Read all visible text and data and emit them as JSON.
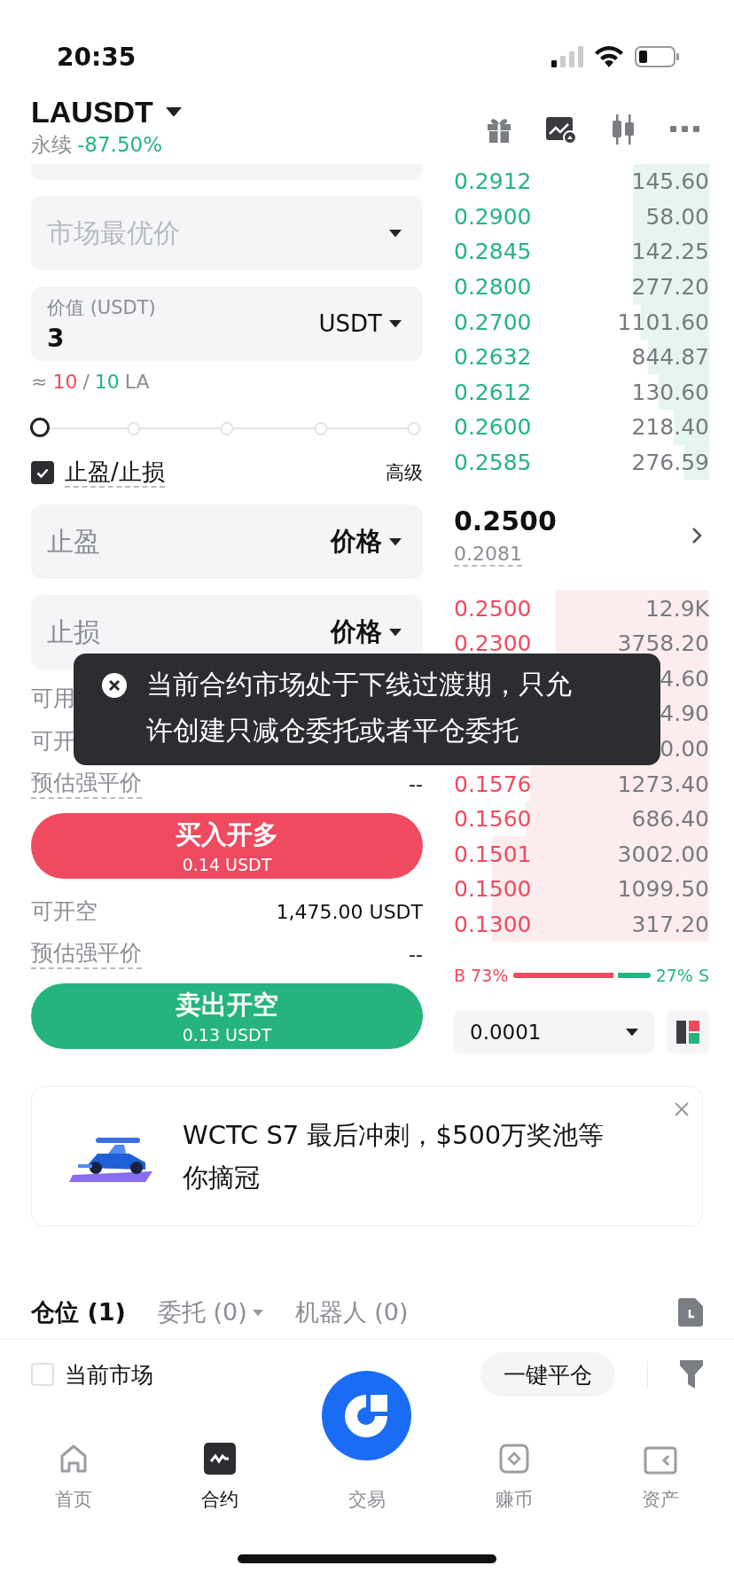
{
  "status_bar": {
    "time": "20:35"
  },
  "header": {
    "symbol": "LAUSDT",
    "type": "永续",
    "change": "-87.50%"
  },
  "order_form": {
    "order_type": {
      "placeholder": "市场最优价"
    },
    "value_field": {
      "label": "价值 (USDT)",
      "value": "3",
      "unit": "USDT"
    },
    "estimate": {
      "prefix": "≈",
      "long": "10",
      "separator": "/",
      "short": "10",
      "unit": "LA"
    },
    "slider": {
      "level": 0
    },
    "tp_sl": {
      "label": "止盈/止损",
      "checked": true,
      "advanced": "高级"
    },
    "tp_field": {
      "placeholder": "止盈",
      "mode": "价格"
    },
    "sl_field": {
      "placeholder": "止损",
      "mode": "价格"
    },
    "long_info": [
      {
        "label": "可用",
        "underlined": false
      },
      {
        "label": "可开",
        "underlined": false
      },
      {
        "label": "预估强平价",
        "value": "--",
        "underlined": true
      }
    ],
    "buy_button": {
      "label": "买入开多",
      "amount": "0.14 USDT"
    },
    "short_info": [
      {
        "label": "可开空",
        "value": "1,475.00 USDT",
        "underlined": false
      },
      {
        "label": "预估强平价",
        "value": "--",
        "underlined": true
      }
    ],
    "sell_button": {
      "label": "卖出开空",
      "amount": "0.13 USDT"
    }
  },
  "order_book": {
    "asks": [
      {
        "price": "0.2912",
        "amount": "145.60"
      },
      {
        "price": "0.2900",
        "amount": "58.00"
      },
      {
        "price": "0.2845",
        "amount": "142.25"
      },
      {
        "price": "0.2800",
        "amount": "277.20"
      },
      {
        "price": "0.2700",
        "amount": "1101.60"
      },
      {
        "price": "0.2632",
        "amount": "844.87"
      },
      {
        "price": "0.2612",
        "amount": "130.60"
      },
      {
        "price": "0.2600",
        "amount": "218.40"
      },
      {
        "price": "0.2585",
        "amount": "276.59"
      }
    ],
    "last_price": "0.2500",
    "mark_price": "0.2081",
    "bids": [
      {
        "price": "0.2500",
        "amount": "12.9K"
      },
      {
        "price": "0.2300",
        "amount": "3758.20"
      },
      {
        "amount": "4.60"
      },
      {
        "amount": "4.90"
      },
      {
        "amount": "0.00"
      },
      {
        "price": "0.1576",
        "amount": "1273.40"
      },
      {
        "price": "0.1560",
        "amount": "686.40"
      },
      {
        "price": "0.1501",
        "amount": "3002.00"
      },
      {
        "price": "0.1500",
        "amount": "1099.50"
      },
      {
        "price": "0.1300",
        "amount": "317.20"
      }
    ],
    "ratio": {
      "buy": "B 73%",
      "sell": "27% S",
      "level": 0.73
    },
    "precision": "0.0001"
  },
  "toast": {
    "message": "当前合约市场处于下线过渡期，只允许创建只减仓委托或者平仓委托"
  },
  "banner": {
    "text": "WCTC S7 最后冲刺，$500万奖池等你摘冠"
  },
  "position_tabs": [
    {
      "label": "仓位 (1)",
      "selected": true,
      "has_menu": false
    },
    {
      "label": "委托 (0)",
      "selected": false,
      "has_menu": true
    },
    {
      "label": "机器人 (0)",
      "selected": false,
      "has_menu": false
    }
  ],
  "position_bar": {
    "filter_label": "当前市场",
    "checked": false,
    "close_all": "一键平仓"
  },
  "bottom_nav": [
    {
      "label": "首页",
      "kind": "home",
      "selected": false
    },
    {
      "label": "合约",
      "kind": "futures",
      "selected": true
    },
    {
      "label": "交易",
      "kind": "center",
      "selected": false
    },
    {
      "label": "赚币",
      "kind": "earn",
      "selected": false
    },
    {
      "label": "资产",
      "kind": "assets",
      "selected": false
    }
  ]
}
